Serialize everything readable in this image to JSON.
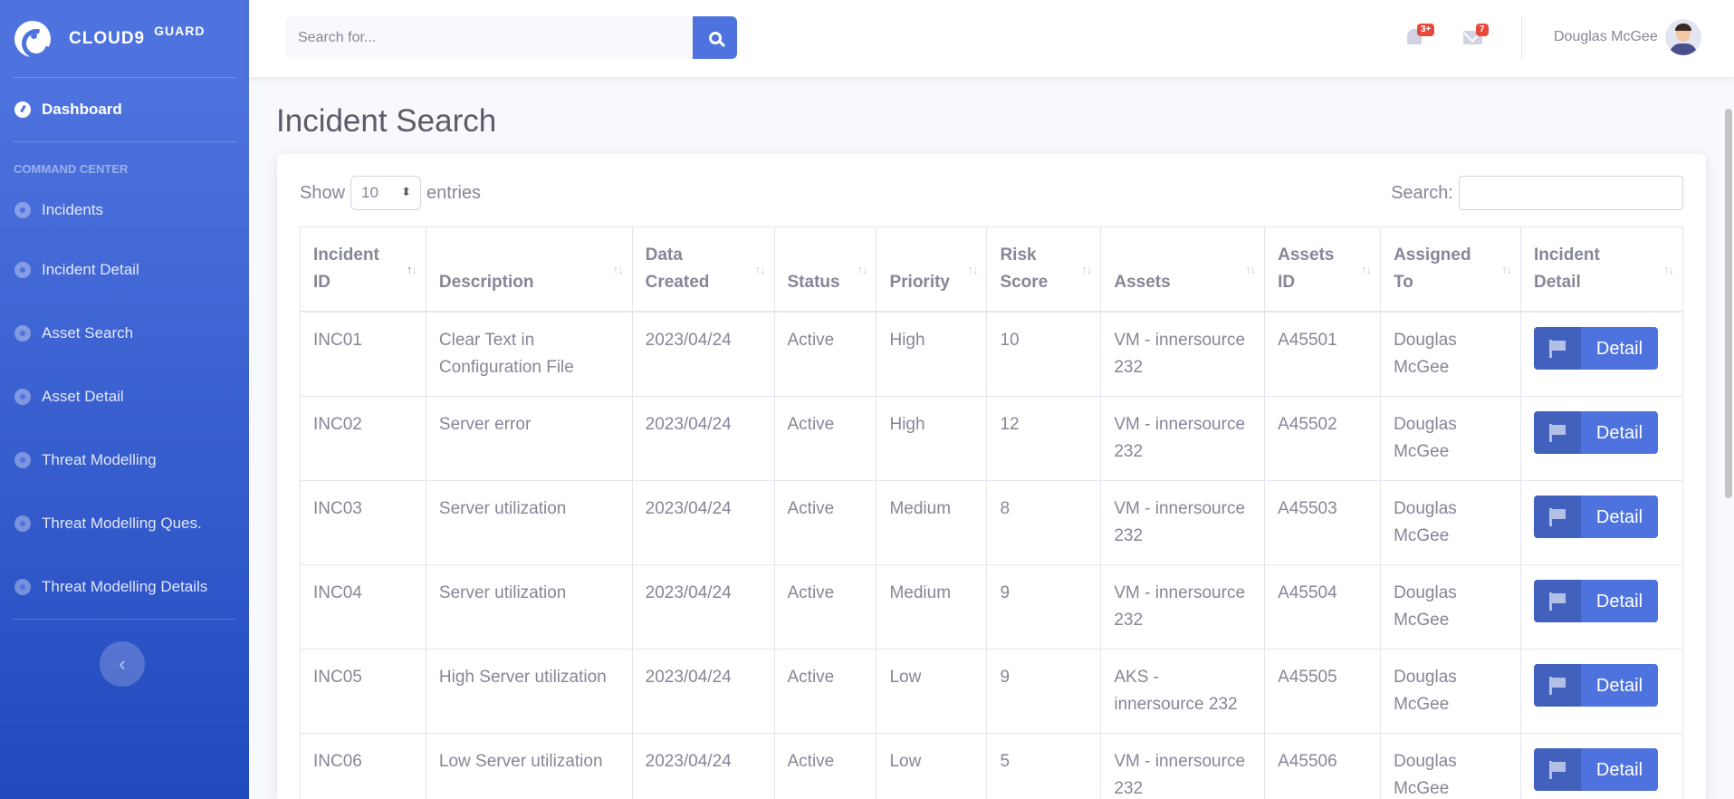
{
  "brand": {
    "name": "CLOUD9",
    "sup": "GUARD"
  },
  "sidebar": {
    "dashboard": "Dashboard",
    "heading": "COMMAND CENTER",
    "items": [
      {
        "label": "Incidents"
      },
      {
        "label": "Incident Detail"
      },
      {
        "label": "Asset Search"
      },
      {
        "label": "Asset Detail"
      },
      {
        "label": "Threat Modelling"
      },
      {
        "label": "Threat Modelling Ques."
      },
      {
        "label": "Threat Modelling Details"
      }
    ],
    "toggle": "‹"
  },
  "topbar": {
    "search_placeholder": "Search for...",
    "alerts_badge": "3+",
    "messages_badge": "7",
    "user_name": "Douglas McGee"
  },
  "page": {
    "title": "Incident Search"
  },
  "table_controls": {
    "show": "Show",
    "entries_value": "10",
    "entries": "entries",
    "search_label": "Search:"
  },
  "table": {
    "headers": [
      {
        "line1": "Incident",
        "line2": "ID"
      },
      {
        "line1": "",
        "line2": "Description"
      },
      {
        "line1": "Data",
        "line2": "Created"
      },
      {
        "line1": "",
        "line2": "Status"
      },
      {
        "line1": "",
        "line2": "Priority"
      },
      {
        "line1": "Risk",
        "line2": "Score"
      },
      {
        "line1": "",
        "line2": "Assets"
      },
      {
        "line1": "Assets",
        "line2": "ID"
      },
      {
        "line1": "Assigned",
        "line2": "To"
      },
      {
        "line1": "Incident",
        "line2": "Detail"
      }
    ],
    "rows": [
      {
        "id": "INC01",
        "description": "Clear Text in Configuration File",
        "created": "2023/04/24",
        "status": "Active",
        "priority": "High",
        "risk": "10",
        "assets": "VM - innersource 232",
        "asset_id": "A45501",
        "assigned": "Douglas McGee",
        "detail": "Detail"
      },
      {
        "id": "INC02",
        "description": "Server error",
        "created": "2023/04/24",
        "status": "Active",
        "priority": "High",
        "risk": "12",
        "assets": "VM - innersource 232",
        "asset_id": "A45502",
        "assigned": "Douglas McGee",
        "detail": "Detail"
      },
      {
        "id": "INC03",
        "description": "Server utilization",
        "created": "2023/04/24",
        "status": "Active",
        "priority": "Medium",
        "risk": "8",
        "assets": "VM - innersource 232",
        "asset_id": "A45503",
        "assigned": "Douglas McGee",
        "detail": "Detail"
      },
      {
        "id": "INC04",
        "description": "Server utilization",
        "created": "2023/04/24",
        "status": "Active",
        "priority": "Medium",
        "risk": "9",
        "assets": "VM - innersource 232",
        "asset_id": "A45504",
        "assigned": "Douglas McGee",
        "detail": "Detail"
      },
      {
        "id": "INC05",
        "description": "High Server utilization",
        "created": "2023/04/24",
        "status": "Active",
        "priority": "Low",
        "risk": "9",
        "assets": "AKS - innersource 232",
        "asset_id": "A45505",
        "assigned": "Douglas McGee",
        "detail": "Detail"
      },
      {
        "id": "INC06",
        "description": "Low Server utilization",
        "created": "2023/04/24",
        "status": "Active",
        "priority": "Low",
        "risk": "5",
        "assets": "VM - innersource 232",
        "asset_id": "A45506",
        "assigned": "Douglas McGee",
        "detail": "Detail"
      }
    ]
  }
}
